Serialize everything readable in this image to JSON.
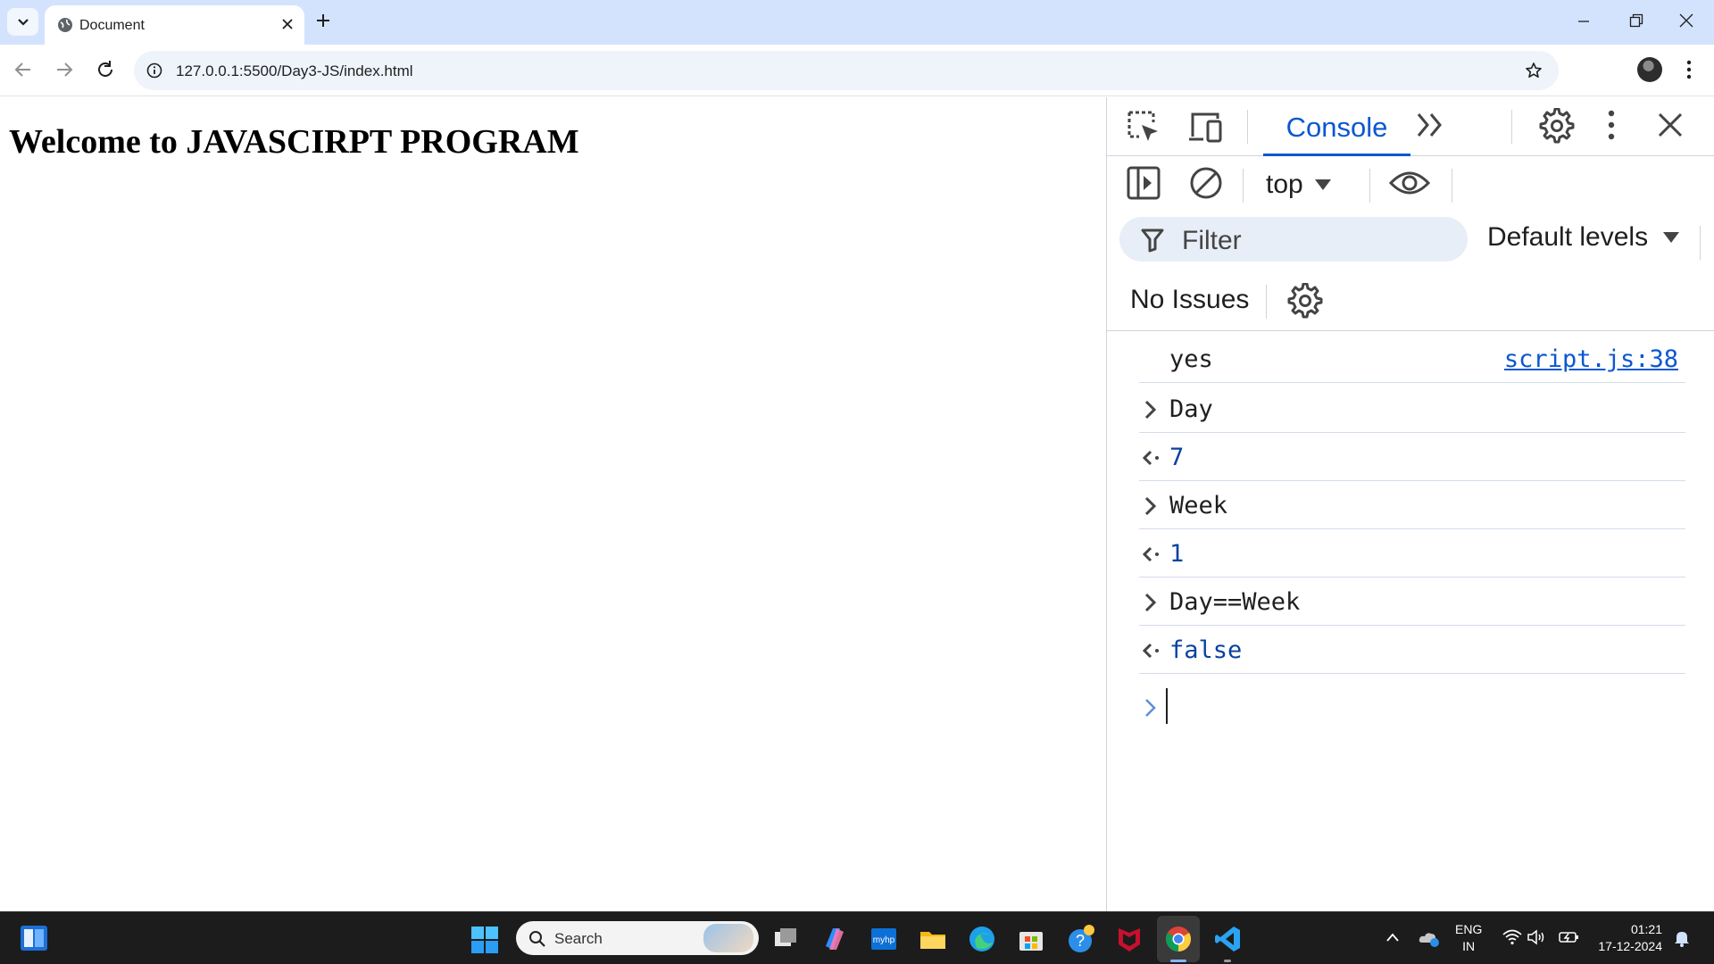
{
  "browser": {
    "tab_title": "Document",
    "url": "127.0.0.1:5500/Day3-JS/index.html"
  },
  "page": {
    "heading": "Welcome to JAVASCIRPT PROGRAM"
  },
  "devtools": {
    "active_tab": "Console",
    "context": "top",
    "filter_placeholder": "Filter",
    "levels": "Default levels",
    "issues": "No Issues",
    "console_rows": [
      {
        "kind": "log",
        "text": "yes",
        "source": "script.js:38"
      },
      {
        "kind": "input",
        "text": "Day"
      },
      {
        "kind": "result",
        "text": "7"
      },
      {
        "kind": "input",
        "text": "Week"
      },
      {
        "kind": "result",
        "text": "1"
      },
      {
        "kind": "input",
        "text": "Day==Week"
      },
      {
        "kind": "result",
        "text": "false"
      }
    ]
  },
  "taskbar": {
    "search_placeholder": "Search",
    "lang_line1": "ENG",
    "lang_line2": "IN",
    "time": "01:21",
    "date": "17-12-2024",
    "apps": [
      "task-view",
      "copilot",
      "myhp",
      "file-explorer",
      "edge",
      "store",
      "tips",
      "mcafee",
      "chrome",
      "vscode"
    ]
  },
  "colors": {
    "tabstrip": "#d3e3fd",
    "devtools_accent": "#0b57d0",
    "result_text": "#0842a0",
    "taskbar": "#1c1c1c"
  }
}
